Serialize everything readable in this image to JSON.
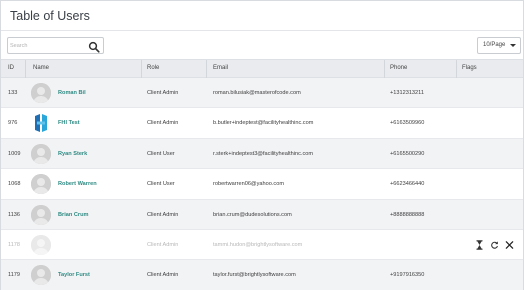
{
  "page": {
    "title": "Table of Users"
  },
  "search": {
    "placeholder": "Search"
  },
  "pagination": {
    "per_page_label": "10/Page"
  },
  "table": {
    "headers": {
      "id": "ID",
      "name": "Name",
      "role": "Role",
      "email": "Email",
      "phone": "Phone",
      "flags": "Flags"
    },
    "rows": [
      {
        "id": "133",
        "name": "Roman Bil",
        "role": "Client Admin",
        "email": "roman.bilusiak@masterofcode.com",
        "phone": "+1312313211",
        "avatar": "default"
      },
      {
        "id": "976",
        "name": "FHI Test",
        "role": "Client Admin",
        "email": "b.butler+indeptest@facilityhealthinc.com",
        "phone": "+6163509960",
        "avatar": "fhi-logo"
      },
      {
        "id": "1009",
        "name": "Ryan Sterk",
        "role": "Client User",
        "email": "r.sterk+indeptest3@facilityhealthinc.com",
        "phone": "+6165500290",
        "avatar": "default"
      },
      {
        "id": "1068",
        "name": "Robert Warren",
        "role": "Client User",
        "email": "robertwarren06@yahoo.com",
        "phone": "+6623466440",
        "avatar": "default"
      },
      {
        "id": "1136",
        "name": "Brian Crum",
        "role": "Client Admin",
        "email": "brian.crum@dudesolutions.com",
        "phone": "+8888888888",
        "avatar": "default"
      },
      {
        "id": "1178",
        "name": "",
        "role": "Client Admin",
        "email": "tammi.hudon@brightlysoftware.com",
        "phone": "",
        "avatar": "default",
        "state": "pending"
      },
      {
        "id": "1179",
        "name": "Taylor Furst",
        "role": "Client Admin",
        "email": "taylor.furst@brightlysoftware.com",
        "phone": "+9197916350",
        "avatar": "default"
      }
    ]
  },
  "icons": {
    "search": "search-icon",
    "caret": "chevron-down-icon",
    "avatar": "user-avatar-icon",
    "logo": "fhi-logo-icon",
    "pending": "hourglass-icon",
    "resend": "refresh-icon",
    "remove": "close-icon"
  },
  "colors": {
    "name_link": "#2e8a83",
    "header_bg": "#e9ebee",
    "alt_row_bg": "#f2f3f5"
  }
}
